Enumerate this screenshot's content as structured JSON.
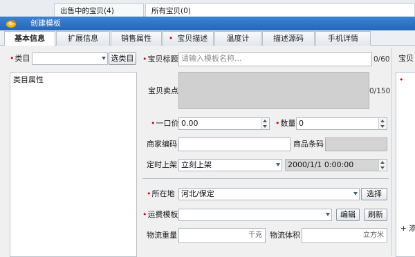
{
  "background_tabs": {
    "on_sale": "出售中的宝贝(4)",
    "all_items": "所有宝贝(0)"
  },
  "dialog": {
    "title": "创建模板"
  },
  "tabs": [
    {
      "label": "基本信息",
      "active": true,
      "required": false
    },
    {
      "label": "扩展信息",
      "active": false,
      "required": false
    },
    {
      "label": "销售属性",
      "active": false,
      "required": false
    },
    {
      "label": "宝贝描述",
      "active": false,
      "required": true
    },
    {
      "label": "温度计",
      "active": false,
      "required": false
    },
    {
      "label": "描述源码",
      "active": false,
      "required": false
    },
    {
      "label": "手机详情",
      "active": false,
      "required": false
    }
  ],
  "left": {
    "category_label": "类目",
    "category_value": "",
    "select_category_button": "选类目",
    "category_attrs_title": "类目属性"
  },
  "form": {
    "title_label": "宝贝标题",
    "title_placeholder": "请输入模板名称...",
    "title_counter": "0/60",
    "selling_points_label": "宝贝卖点",
    "selling_points_counter": "0/150",
    "price_label": "一口价",
    "price_value": "0.00",
    "quantity_label": "数量",
    "quantity_value": "0",
    "merchant_code_label": "商家编码",
    "merchant_code_value": "",
    "barcode_label": "商品条码",
    "barcode_value": "",
    "schedule_label": "定时上架",
    "schedule_value": "立刻上架",
    "schedule_datetime": "2000/1/1 0:00:00",
    "location_label": "所在地",
    "location_value": "河北/保定",
    "location_button": "选择",
    "shipping_label": "运费模板",
    "shipping_value": "",
    "edit_button": "编辑",
    "refresh_button": "刷新",
    "weight_label": "物流重量",
    "weight_unit": "千克",
    "volume_label": "物流体积",
    "volume_unit": "立方米"
  },
  "right_panel": {
    "header": "宝贝",
    "add_link": "+ 添"
  },
  "colors": {
    "titlebar": "#2c6fc2",
    "required": "#d60000"
  }
}
